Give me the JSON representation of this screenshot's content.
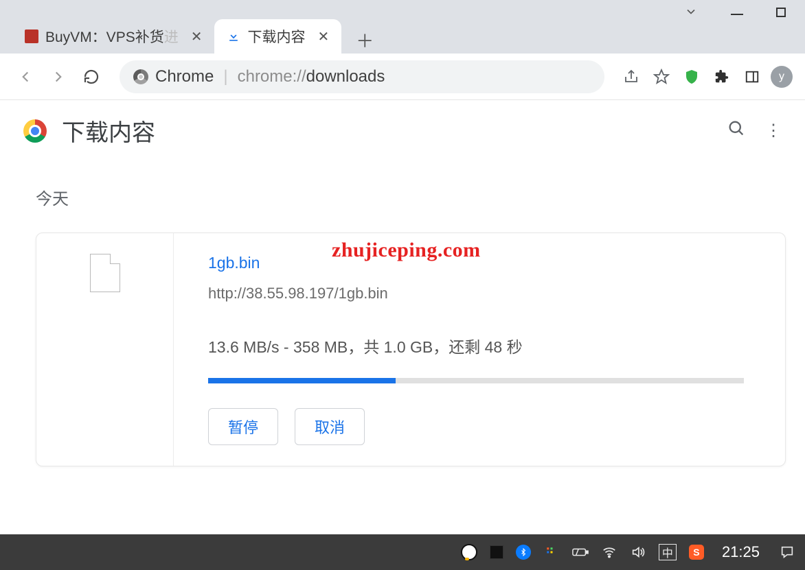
{
  "tabs": {
    "inactive_title": "BuyVM：VPS补货",
    "inactive_title_fade": "进",
    "active_title": "下载内容"
  },
  "addressbar": {
    "badge_label": "Chrome",
    "url_prefix": "chrome://",
    "url_bold": "downloads"
  },
  "header": {
    "title": "下载内容"
  },
  "section_date": "今天",
  "download": {
    "filename": "1gb.bin",
    "url": "http://38.55.98.197/1gb.bin",
    "status": "13.6 MB/s - 358 MB，共 1.0 GB，还剩 48 秒",
    "progress_percent": 35,
    "pause_label": "暂停",
    "cancel_label": "取消"
  },
  "watermark": "zhujiceping.com",
  "avatar_letter": "y",
  "ime_label": "中",
  "sogou_letter": "S",
  "clock": "21:25"
}
